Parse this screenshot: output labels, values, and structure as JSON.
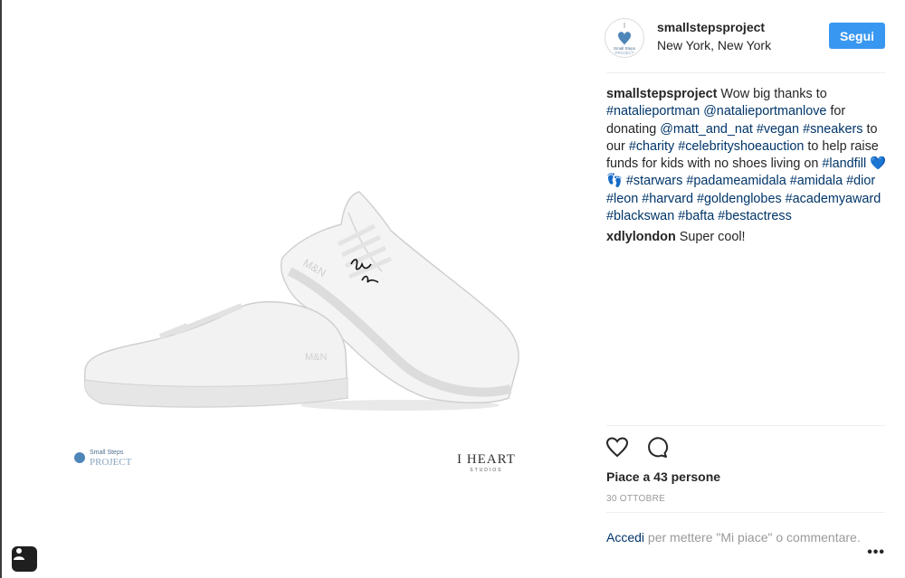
{
  "post": {
    "username": "smallstepsproject",
    "location": "New York, New York",
    "follow_label": "Segui"
  },
  "caption": {
    "author": "smallstepsproject",
    "segments": [
      {
        "t": "Wow big thanks to ",
        "tag": false
      },
      {
        "t": "#natalieportman",
        "tag": true
      },
      {
        "t": " ",
        "tag": false
      },
      {
        "t": "@natalieportmanlove",
        "tag": true
      },
      {
        "t": " for donating ",
        "tag": false
      },
      {
        "t": "@matt_and_nat",
        "tag": true
      },
      {
        "t": " ",
        "tag": false
      },
      {
        "t": "#vegan",
        "tag": true
      },
      {
        "t": " ",
        "tag": false
      },
      {
        "t": "#sneakers",
        "tag": true
      },
      {
        "t": " to our ",
        "tag": false
      },
      {
        "t": "#charity",
        "tag": true
      },
      {
        "t": " ",
        "tag": false
      },
      {
        "t": "#celebrityshoeauction",
        "tag": true
      },
      {
        "t": " to help raise funds for kids with no shoes living on ",
        "tag": false
      },
      {
        "t": "#landfill",
        "tag": true
      },
      {
        "t": " 💙👣 ",
        "tag": false
      },
      {
        "t": "#starwars",
        "tag": true
      },
      {
        "t": " ",
        "tag": false
      },
      {
        "t": "#padameamidala",
        "tag": true
      },
      {
        "t": " ",
        "tag": false
      },
      {
        "t": "#amidala",
        "tag": true
      },
      {
        "t": " ",
        "tag": false
      },
      {
        "t": "#dior",
        "tag": true
      },
      {
        "t": " ",
        "tag": false
      },
      {
        "t": "#leon",
        "tag": true
      },
      {
        "t": " ",
        "tag": false
      },
      {
        "t": "#harvard",
        "tag": true
      },
      {
        "t": " ",
        "tag": false
      },
      {
        "t": "#goldenglobes",
        "tag": true
      },
      {
        "t": " ",
        "tag": false
      },
      {
        "t": "#academyaward",
        "tag": true
      },
      {
        "t": " ",
        "tag": false
      },
      {
        "t": "#blackswan",
        "tag": true
      },
      {
        "t": " ",
        "tag": false
      },
      {
        "t": "#bafta",
        "tag": true
      },
      {
        "t": " ",
        "tag": false
      },
      {
        "t": "#bestactress",
        "tag": true
      }
    ]
  },
  "reply": {
    "author": "xdlylondon",
    "text": "Super cool!"
  },
  "likes_text": "Piace a 43 persone",
  "date": "30 OTTOBRE",
  "login": {
    "link": "Accedi",
    "text": " per mettere \"Mi piace\" o commentare."
  },
  "more_label": "•••",
  "photo": {
    "brand_left_line1": "Small Steps",
    "brand_left_line2": "PROJECT",
    "brand_right_line1": "I HEART",
    "brand_right_line2": "STUDIOS",
    "avatar_line1": "Small Steps",
    "avatar_line2": "PROJECT",
    "shoe_logo": "M&N"
  },
  "icons": {
    "like": "heart-icon",
    "comment": "comment-icon",
    "tag": "person-tag-icon"
  },
  "colors": {
    "accent": "#3897f0",
    "link": "#003569",
    "muted": "#999999"
  }
}
